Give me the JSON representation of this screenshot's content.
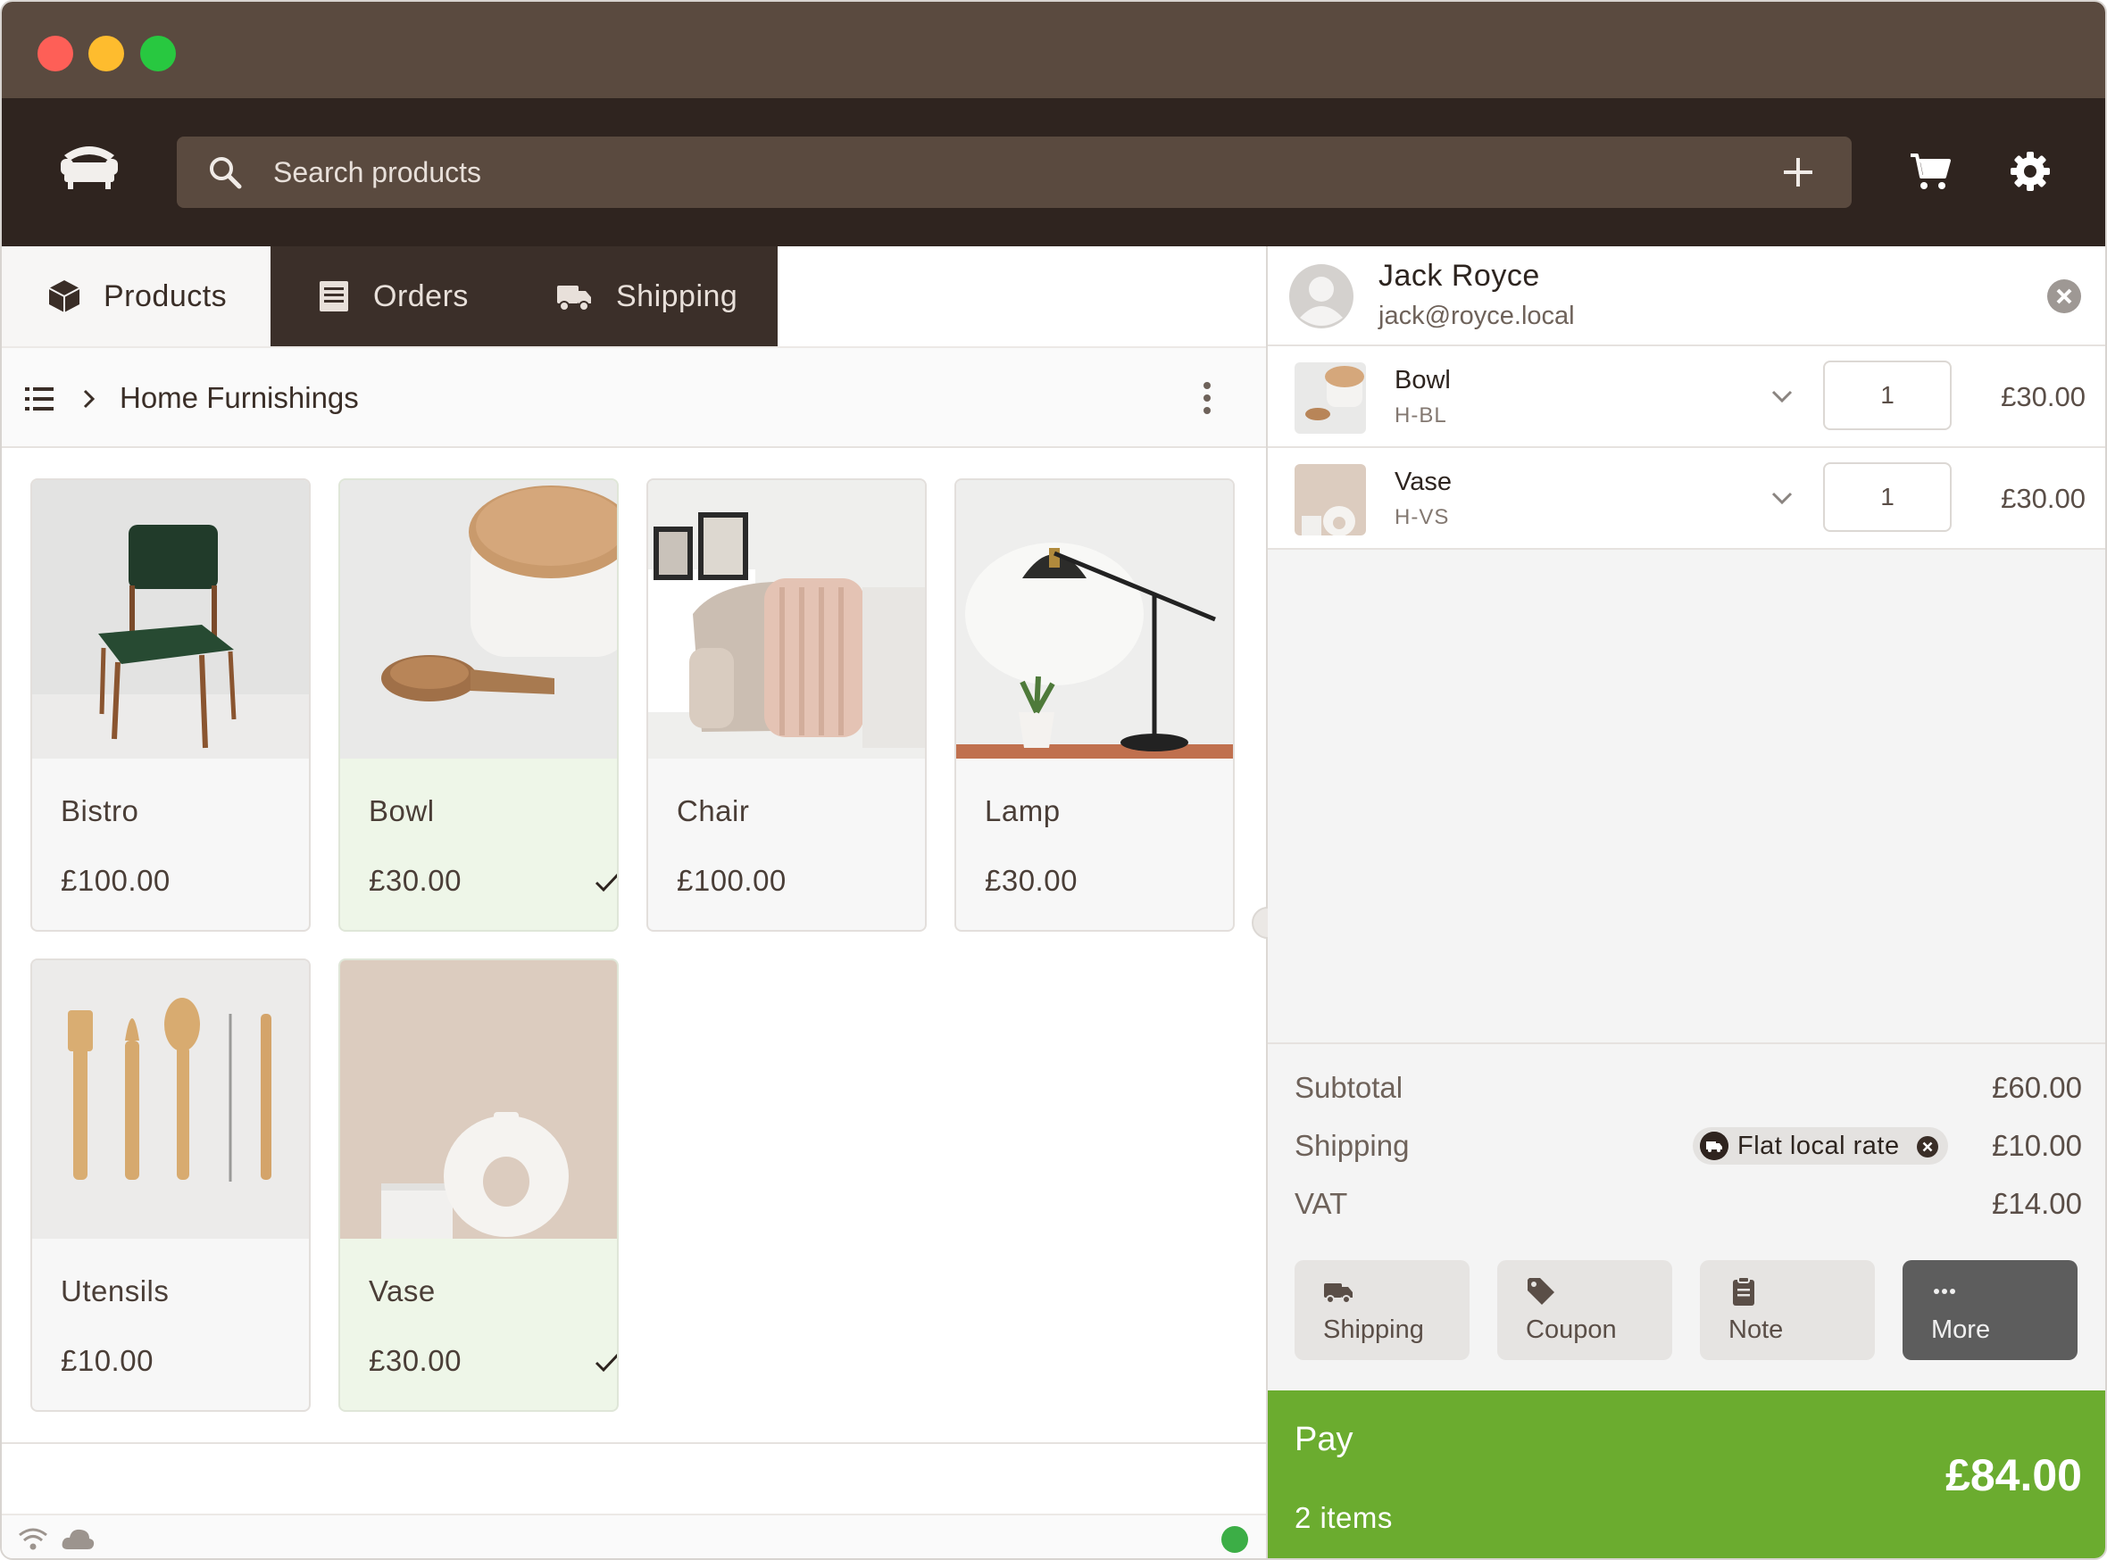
{
  "search": {
    "placeholder": "Search products"
  },
  "tabs": [
    {
      "label": "Products",
      "active": true
    },
    {
      "label": "Orders",
      "active": false
    },
    {
      "label": "Shipping",
      "active": false
    }
  ],
  "breadcrumb": {
    "category": "Home Furnishings"
  },
  "products": [
    {
      "name": "Bistro",
      "price": "£100.00",
      "selected": false
    },
    {
      "name": "Bowl",
      "price": "£30.00",
      "selected": true
    },
    {
      "name": "Chair",
      "price": "£100.00",
      "selected": false
    },
    {
      "name": "Lamp",
      "price": "£30.00",
      "selected": false
    },
    {
      "name": "Utensils",
      "price": "£10.00",
      "selected": false
    },
    {
      "name": "Vase",
      "price": "£30.00",
      "selected": true
    }
  ],
  "customer": {
    "name": "Jack Royce",
    "email": "jack@royce.local"
  },
  "cart": {
    "lines": [
      {
        "name": "Bowl",
        "sku": "H-BL",
        "qty": "1",
        "price": "£30.00"
      },
      {
        "name": "Vase",
        "sku": "H-VS",
        "qty": "1",
        "price": "£30.00"
      }
    ],
    "subtotal_label": "Subtotal",
    "subtotal": "£60.00",
    "shipping_label": "Shipping",
    "shipping_method": "Flat local rate",
    "shipping": "£10.00",
    "vat_label": "VAT",
    "vat": "£14.00"
  },
  "actions": [
    {
      "label": "Shipping",
      "icon": "truck-icon"
    },
    {
      "label": "Coupon",
      "icon": "tag-icon"
    },
    {
      "label": "Note",
      "icon": "clipboard-icon"
    },
    {
      "label": "More",
      "icon": "ellipsis-icon"
    }
  ],
  "pay": {
    "label": "Pay",
    "items": "2 items",
    "total": "£84.00"
  },
  "colors": {
    "header": "#2f241f",
    "titlebar": "#5a4a3f",
    "pay": "#6bac2f",
    "selected_card": "#eef6e8",
    "online": "#3cae46"
  }
}
